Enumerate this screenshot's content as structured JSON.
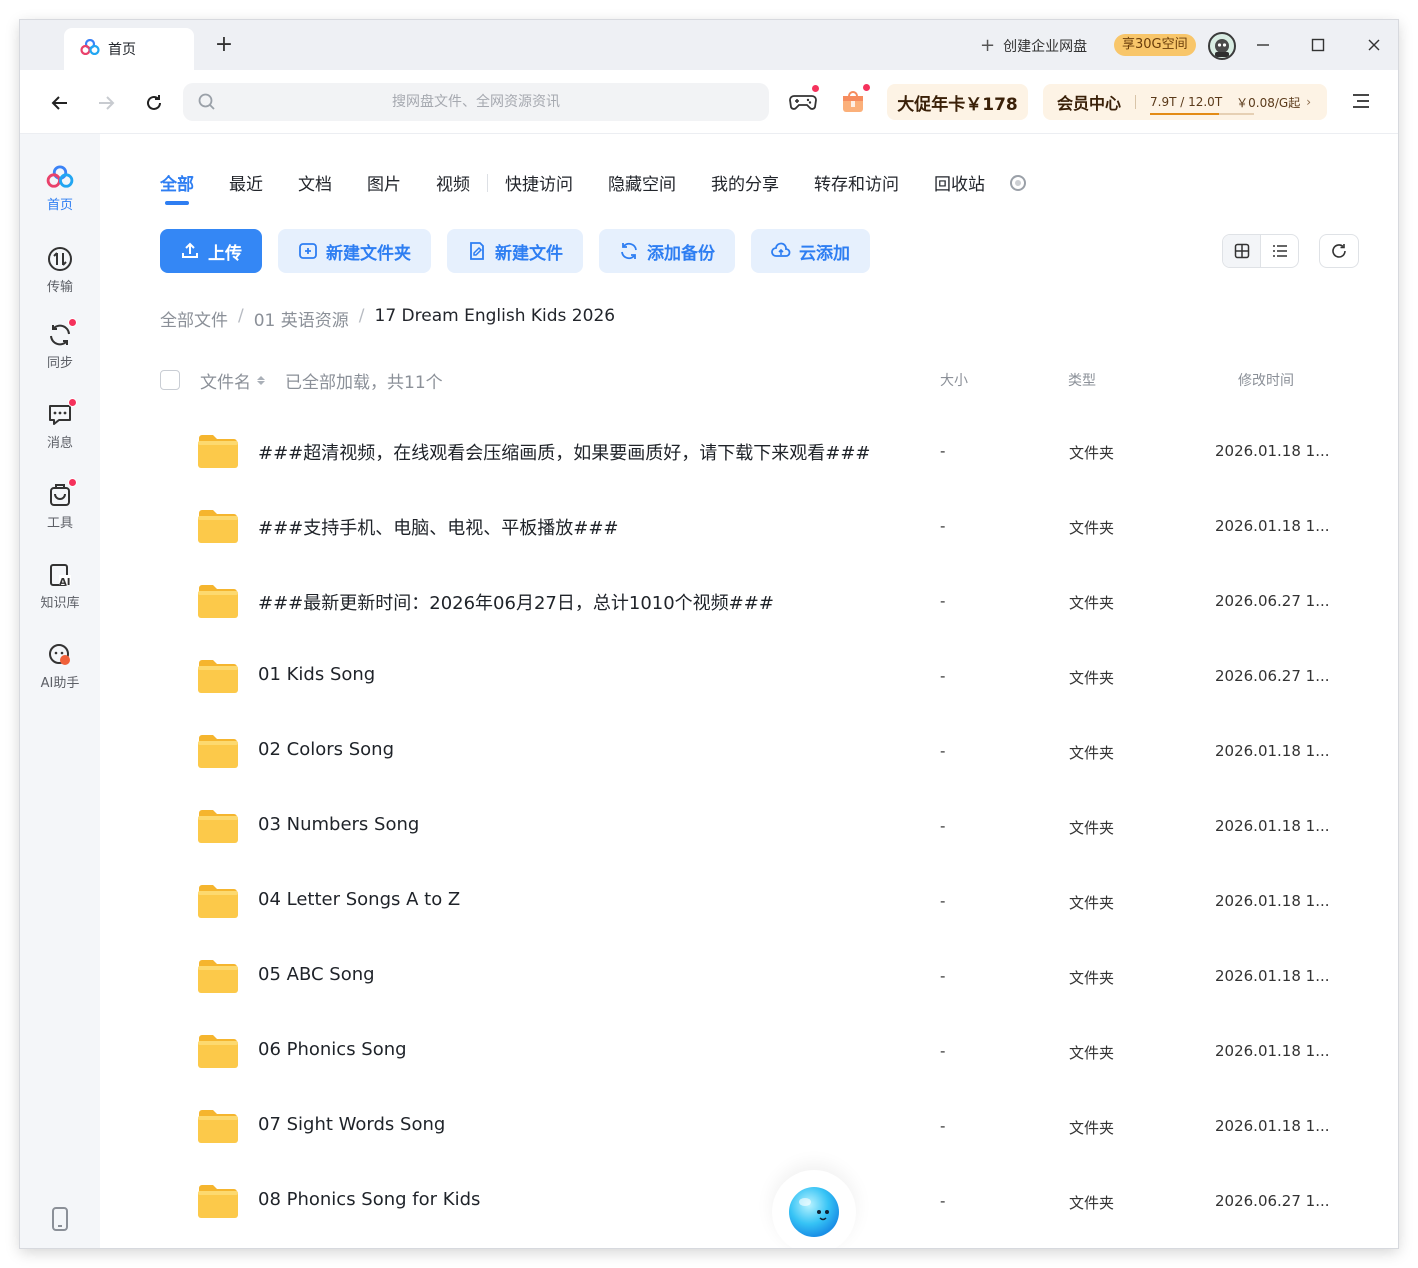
{
  "tabbar": {
    "tab_label": "首页",
    "create_enterprise": "创建企业网盘",
    "space_badge": "享30G空间"
  },
  "search": {
    "placeholder": "搜网盘文件、全网资源资讯"
  },
  "promo": {
    "label": "大促年卡￥178"
  },
  "vip": {
    "label": "会员中心",
    "quota": "7.9T / 12.0T",
    "quota_used_fraction": 0.66,
    "price": "￥0.08/G起"
  },
  "sidebar": {
    "items": [
      {
        "label": "首页",
        "icon": "home-cloud-icon",
        "active": true
      },
      {
        "label": "传输",
        "icon": "transfer-icon"
      },
      {
        "label": "同步",
        "icon": "sync-icon",
        "badge": true
      },
      {
        "label": "消息",
        "icon": "message-icon",
        "badge": true
      },
      {
        "label": "工具",
        "icon": "toolbox-icon",
        "badge": true
      },
      {
        "label": "知识库",
        "icon": "knowledge-ai-icon"
      },
      {
        "label": "AI助手",
        "icon": "ai-assistant-icon"
      }
    ]
  },
  "categories": [
    "全部",
    "最近",
    "文档",
    "图片",
    "视频",
    "快捷访问",
    "隐藏空间",
    "我的分享",
    "转存和访问",
    "回收站"
  ],
  "actions": {
    "upload": "上传",
    "new_folder": "新建文件夹",
    "new_file": "新建文件",
    "add_backup": "添加备份",
    "cloud_add": "云添加"
  },
  "breadcrumb": {
    "root": "全部文件",
    "level1": "01 英语资源",
    "current": "17 Dream English Kids 2026"
  },
  "table": {
    "col_name": "文件名",
    "loaded_text": "已全部加载，共11个",
    "col_size": "大小",
    "col_type": "类型",
    "col_mtime": "修改时间",
    "rows": [
      {
        "name": "###超清视频，在线观看会压缩画质，如果要画质好，请下载下来观看###",
        "size": "-",
        "type": "文件夹",
        "mtime": "2026.01.18 1..."
      },
      {
        "name": "###支持手机、电脑、电视、平板播放###",
        "size": "-",
        "type": "文件夹",
        "mtime": "2026.01.18 1..."
      },
      {
        "name": "###最新更新时间：2026年06月27日，总计1010个视频###",
        "size": "-",
        "type": "文件夹",
        "mtime": "2026.06.27 1..."
      },
      {
        "name": "01 Kids Song",
        "size": "-",
        "type": "文件夹",
        "mtime": "2026.06.27 1..."
      },
      {
        "name": "02 Colors Song",
        "size": "-",
        "type": "文件夹",
        "mtime": "2026.01.18 1..."
      },
      {
        "name": "03 Numbers Song",
        "size": "-",
        "type": "文件夹",
        "mtime": "2026.01.18 1..."
      },
      {
        "name": "04 Letter Songs A to Z",
        "size": "-",
        "type": "文件夹",
        "mtime": "2026.01.18 1..."
      },
      {
        "name": "05 ABC Song",
        "size": "-",
        "type": "文件夹",
        "mtime": "2026.01.18 1..."
      },
      {
        "name": "06 Phonics Song",
        "size": "-",
        "type": "文件夹",
        "mtime": "2026.01.18 1..."
      },
      {
        "name": "07 Sight Words Song",
        "size": "-",
        "type": "文件夹",
        "mtime": "2026.01.18 1..."
      },
      {
        "name": "08 Phonics Song for Kids",
        "size": "-",
        "type": "文件夹",
        "mtime": "2026.06.27 1..."
      }
    ]
  },
  "colors": {
    "accent": "#2e7ef2",
    "folder": "#fcc94a",
    "promo_bg": "#fdf3e5",
    "badge_red": "#f5325c"
  }
}
